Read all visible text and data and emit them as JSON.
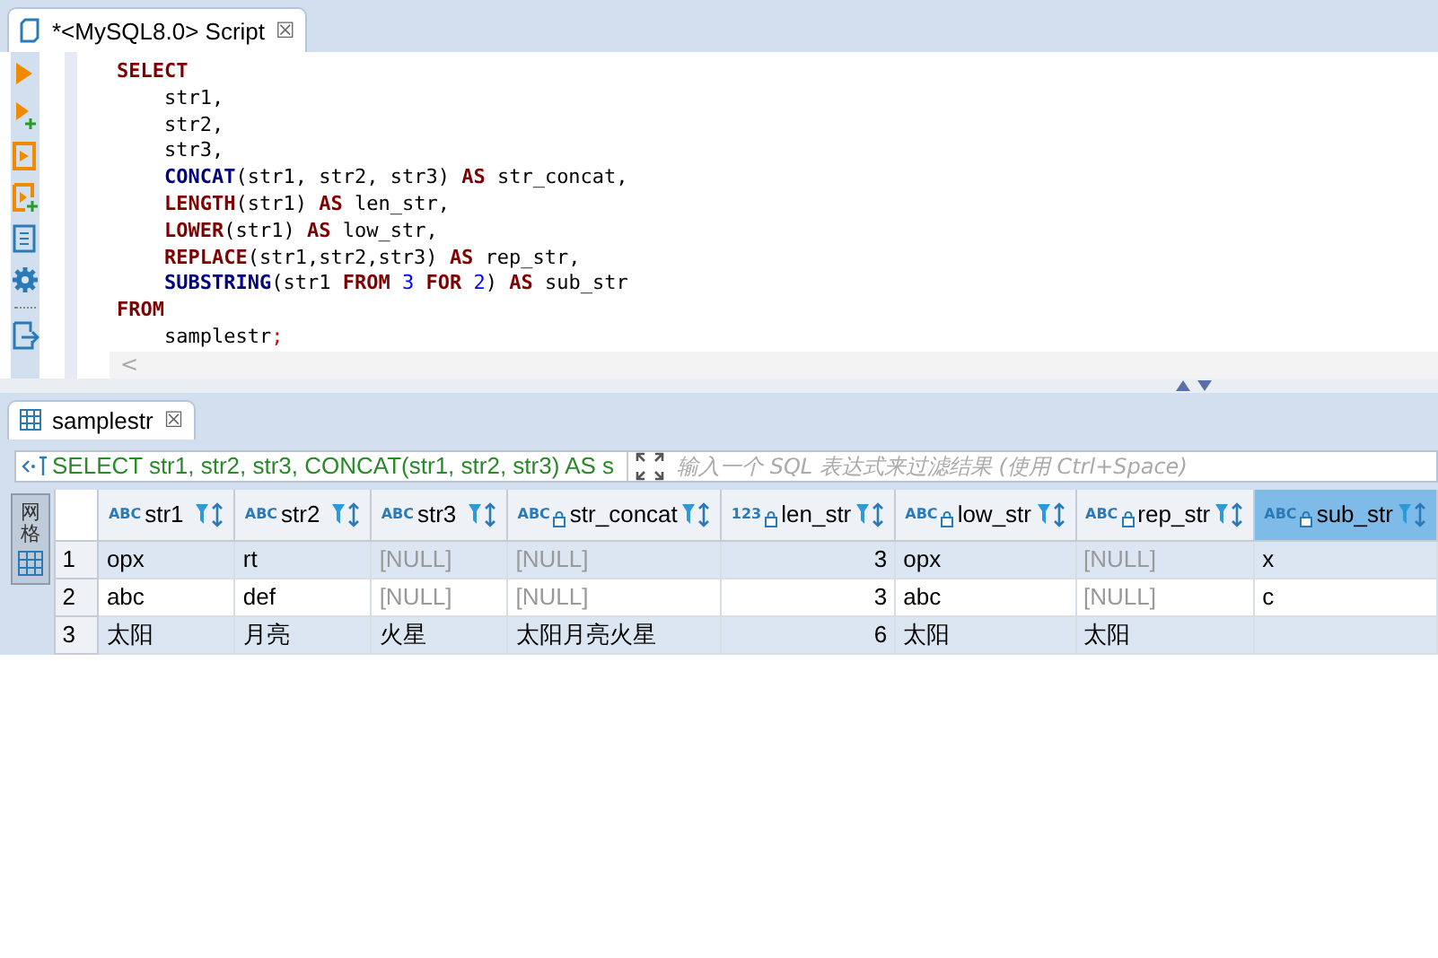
{
  "editor_tab": {
    "title": "*<MySQL8.0> Script",
    "close": "☒",
    "selected": true
  },
  "toolbar": [
    {
      "kind": "run"
    },
    {
      "kind": "run-new"
    },
    {
      "kind": "script"
    },
    {
      "kind": "script-new"
    },
    {
      "kind": "explain"
    },
    {
      "kind": "gear"
    },
    {
      "kind": "sep"
    },
    {
      "kind": "export"
    }
  ],
  "code_lines": [
    {
      "indent": false,
      "tokens": [
        {
          "kind": "keyword",
          "text": "SELECT"
        }
      ]
    },
    {
      "indent": true,
      "tokens": [
        {
          "kind": "plain",
          "text": "str1,"
        }
      ]
    },
    {
      "indent": true,
      "tokens": [
        {
          "kind": "plain",
          "text": "str2,"
        }
      ]
    },
    {
      "indent": true,
      "tokens": [
        {
          "kind": "plain",
          "text": "str3,"
        }
      ]
    },
    {
      "indent": true,
      "tokens": [
        {
          "kind": "function",
          "text": "CONCAT"
        },
        {
          "kind": "plain",
          "text": "(str1, str2, str3) "
        },
        {
          "kind": "keyword",
          "text": "AS"
        },
        {
          "kind": "plain",
          "text": " str_concat,"
        }
      ]
    },
    {
      "indent": true,
      "tokens": [
        {
          "kind": "keyword",
          "text": "LENGTH"
        },
        {
          "kind": "plain",
          "text": "(str1) "
        },
        {
          "kind": "keyword",
          "text": "AS"
        },
        {
          "kind": "plain",
          "text": " len_str,"
        }
      ]
    },
    {
      "indent": true,
      "tokens": [
        {
          "kind": "keyword",
          "text": "LOWER"
        },
        {
          "kind": "plain",
          "text": "(str1) "
        },
        {
          "kind": "keyword",
          "text": "AS"
        },
        {
          "kind": "plain",
          "text": " low_str,"
        }
      ]
    },
    {
      "indent": true,
      "tokens": [
        {
          "kind": "keyword",
          "text": "REPLACE"
        },
        {
          "kind": "plain",
          "text": "(str1,str2,str3) "
        },
        {
          "kind": "keyword",
          "text": "AS"
        },
        {
          "kind": "plain",
          "text": " rep_str,"
        }
      ]
    },
    {
      "indent": true,
      "tokens": [
        {
          "kind": "function",
          "text": "SUBSTRING"
        },
        {
          "kind": "plain",
          "text": "(str1 "
        },
        {
          "kind": "keyword",
          "text": "FROM"
        },
        {
          "kind": "number",
          "text": " 3 "
        },
        {
          "kind": "keyword",
          "text": "FOR"
        },
        {
          "kind": "number",
          "text": " 2"
        },
        {
          "kind": "plain",
          "text": ") "
        },
        {
          "kind": "keyword",
          "text": "AS"
        },
        {
          "kind": "plain",
          "text": " sub_str"
        }
      ]
    },
    {
      "indent": false,
      "tokens": [
        {
          "kind": "keyword",
          "text": "FROM"
        }
      ]
    },
    {
      "indent": true,
      "tokens": [
        {
          "kind": "plain",
          "text": "samplestr"
        },
        {
          "kind": "punct",
          "text": ";"
        }
      ]
    }
  ],
  "scroll_left": "<",
  "results_tab": {
    "title": "samplestr",
    "close": "☒",
    "selected": true
  },
  "filter": {
    "query": "SELECT str1, str2, str3, CONCAT(str1, str2, str3) AS s",
    "placeholder": "输入一个 SQL 表达式来过滤结果 (使用 Ctrl+Space)"
  },
  "side_tab": {
    "label": "网格",
    "selected": true
  },
  "table": {
    "columns": [
      {
        "name": "str1",
        "type_label": "ABC",
        "numeric": false,
        "locked": false,
        "selected": false
      },
      {
        "name": "str2",
        "type_label": "ABC",
        "numeric": false,
        "locked": false,
        "selected": false
      },
      {
        "name": "str3",
        "type_label": "ABC",
        "numeric": false,
        "locked": false,
        "selected": false
      },
      {
        "name": "str_concat",
        "type_label": "ABC",
        "numeric": false,
        "locked": true,
        "selected": false
      },
      {
        "name": "len_str",
        "type_label": "123",
        "numeric": true,
        "locked": true,
        "selected": false
      },
      {
        "name": "low_str",
        "type_label": "ABC",
        "numeric": false,
        "locked": true,
        "selected": false
      },
      {
        "name": "rep_str",
        "type_label": "ABC",
        "numeric": false,
        "locked": true,
        "selected": false
      },
      {
        "name": "sub_str",
        "type_label": "ABC",
        "numeric": false,
        "locked": true,
        "selected": true
      }
    ],
    "rows": [
      {
        "number": "1",
        "cells": [
          "opx",
          "rt",
          "[NULL]",
          "[NULL]",
          "3",
          "opx",
          "[NULL]",
          "x"
        ]
      },
      {
        "number": "2",
        "cells": [
          "abc",
          "def",
          "[NULL]",
          "[NULL]",
          "3",
          "abc",
          "[NULL]",
          "c"
        ]
      },
      {
        "number": "3",
        "cells": [
          "太阳",
          "月亮",
          "火星",
          "太阳月亮火星",
          "6",
          "太阳",
          "太阳",
          ""
        ]
      }
    ]
  }
}
